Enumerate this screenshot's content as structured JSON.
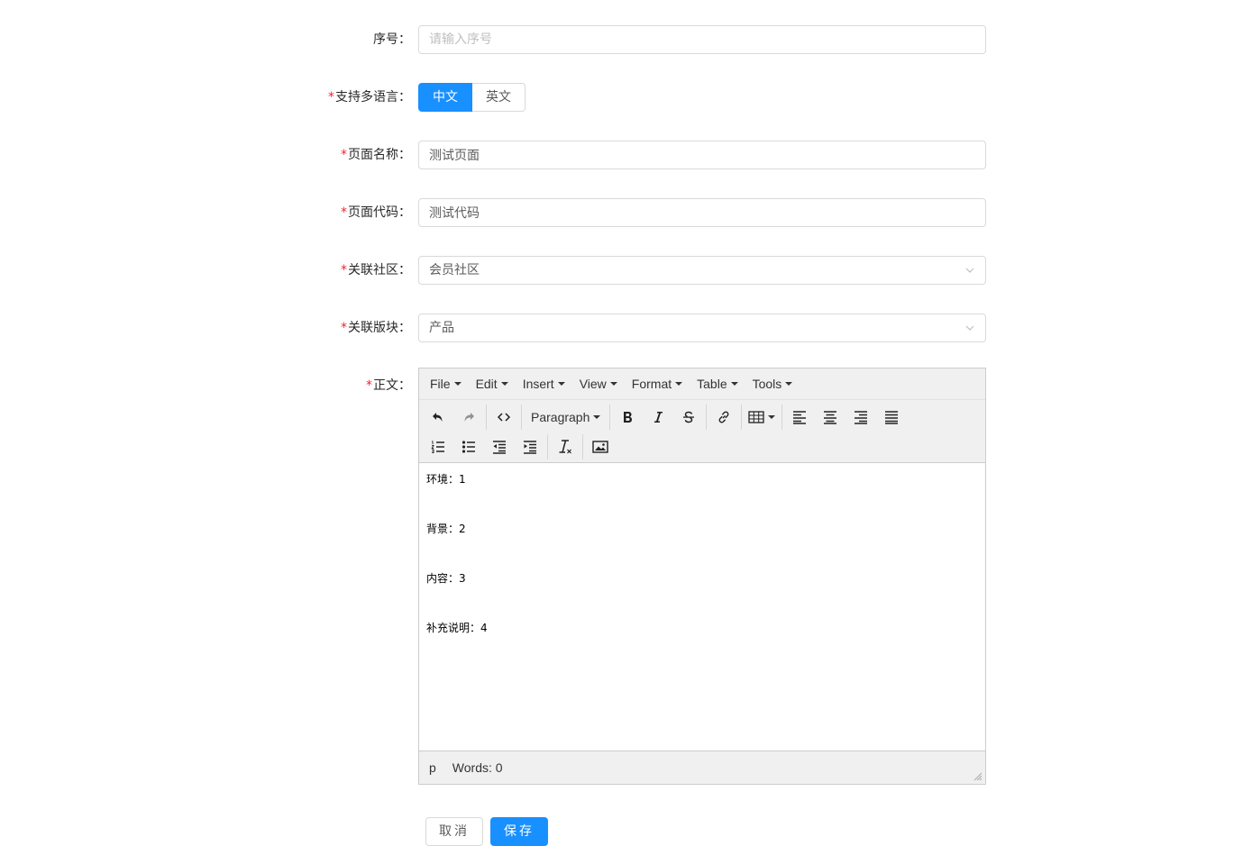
{
  "form": {
    "serial": {
      "label": "序号",
      "placeholder": "请输入序号",
      "value": ""
    },
    "multi_lang": {
      "label": "支持多语言",
      "options": [
        "中文",
        "英文"
      ],
      "selected": "中文"
    },
    "page_name": {
      "label": "页面名称",
      "value": "测试页面"
    },
    "page_code": {
      "label": "页面代码",
      "value": "测试代码"
    },
    "community": {
      "label": "关联社区",
      "value": "会员社区"
    },
    "section": {
      "label": "关联版块",
      "value": "产品"
    },
    "body": {
      "label": "正文"
    }
  },
  "editor": {
    "menus": [
      "File",
      "Edit",
      "Insert",
      "View",
      "Format",
      "Table",
      "Tools"
    ],
    "format_select": "Paragraph",
    "content": [
      "环境：1",
      "背景：2",
      "内容：3",
      "补充说明：4"
    ],
    "status_path": "p",
    "word_count": "Words: 0"
  },
  "actions": {
    "cancel": "取消",
    "save": "保存"
  },
  "colors": {
    "primary": "#1890ff",
    "required": "#f5222d"
  }
}
